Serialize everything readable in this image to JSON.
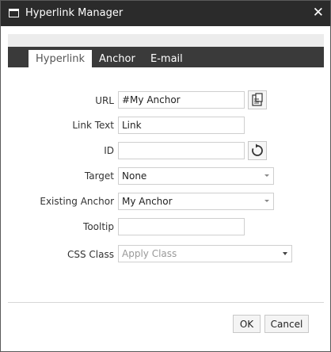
{
  "window": {
    "title": "Hyperlink Manager",
    "close_glyph": "✕"
  },
  "tabs": [
    {
      "label": "Hyperlink",
      "active": true
    },
    {
      "label": "Anchor",
      "active": false
    },
    {
      "label": "E-mail",
      "active": false
    }
  ],
  "form": {
    "url": {
      "label": "URL",
      "value": "#My Anchor"
    },
    "link_text": {
      "label": "Link Text",
      "value": "Link"
    },
    "id": {
      "label": "ID",
      "value": ""
    },
    "target": {
      "label": "Target",
      "selected": "None"
    },
    "existing_anchor": {
      "label": "Existing Anchor",
      "selected": "My Anchor"
    },
    "tooltip": {
      "label": "Tooltip",
      "value": ""
    },
    "css_class": {
      "label": "CSS Class",
      "selected": "Apply Class"
    }
  },
  "icons": {
    "window_icon": "window-icon",
    "close": "close-icon",
    "document_manager": "document-manager-icon",
    "refresh": "refresh-icon"
  },
  "buttons": {
    "ok": "OK",
    "cancel": "Cancel"
  },
  "colors": {
    "titlebar": "#2b2b2b",
    "tabbar": "#3a3a3a",
    "active_tab": "#ffffff",
    "border": "#cfcfcf"
  }
}
